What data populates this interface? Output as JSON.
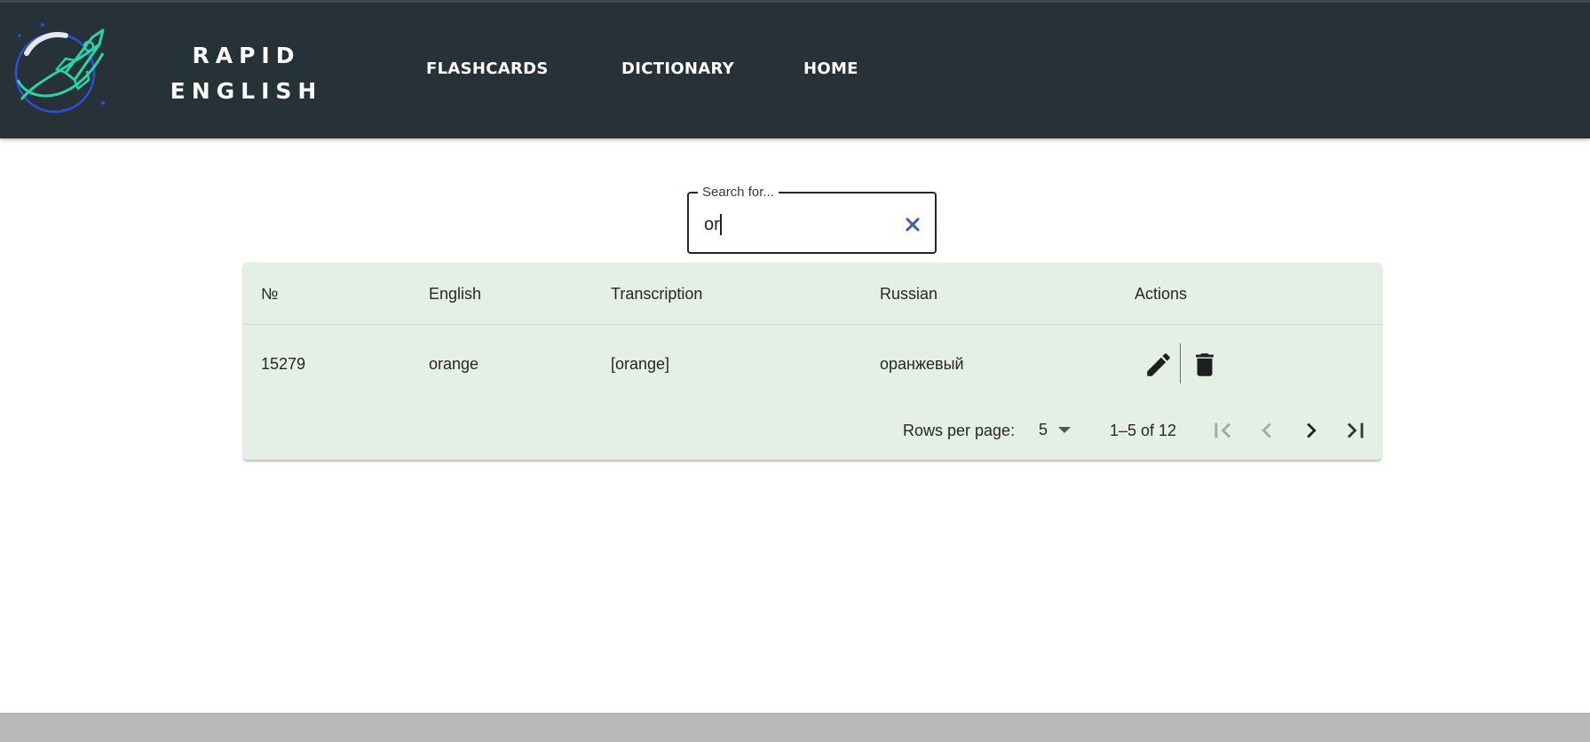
{
  "header": {
    "brand_line1": "RAPID",
    "brand_line2": "ENGLISH",
    "logo_icon": "rocket-globe-logo",
    "nav": [
      {
        "label": "FLASHCARDS"
      },
      {
        "label": "DICTIONARY"
      },
      {
        "label": "HOME"
      }
    ]
  },
  "search": {
    "legend": "Search for...",
    "value": "or",
    "clear_icon": "close-icon"
  },
  "table": {
    "columns": [
      "№",
      "English",
      "Transcription",
      "Russian",
      "Actions"
    ],
    "rows": [
      {
        "number": "15279",
        "english": "orange",
        "transcription": "[orange]",
        "russian": "оранжевый",
        "actions": [
          "edit-icon",
          "delete-icon"
        ]
      }
    ]
  },
  "pagination": {
    "rows_per_page_label": "Rows per page:",
    "rows_per_page": "5",
    "range": "1–5 of 12"
  },
  "colors": {
    "header_bg": "#273238",
    "table_bg": "#e4f0e5",
    "logo_teal": "#2bd3a8",
    "logo_blue": "#2b4fd6",
    "footer_bg": "#b9b9b9"
  }
}
